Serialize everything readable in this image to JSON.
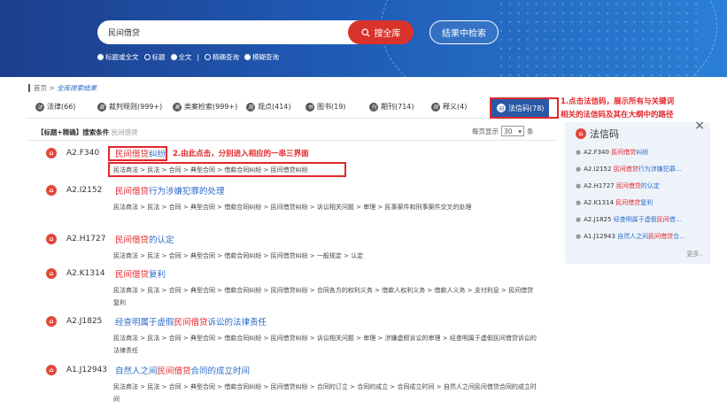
{
  "search": {
    "query": "民间借贷",
    "btn_all": "搜全库",
    "btn_within": "结果中检索",
    "options": [
      {
        "label": "标题或全文",
        "on": true
      },
      {
        "label": "标题",
        "on": false
      },
      {
        "label": "全文",
        "on": true
      },
      {
        "label": "精确查询",
        "on": false
      },
      {
        "label": "模糊查询",
        "on": true
      }
    ]
  },
  "breadcrumb": {
    "home": "首页",
    "sep": " > ",
    "current": "全库搜索结果"
  },
  "tabs": [
    {
      "label": "法律(66)",
      "icon": "法"
    },
    {
      "label": "裁判规则(999+)",
      "icon": "裁"
    },
    {
      "label": "类案检索(999+)",
      "icon": "案"
    },
    {
      "label": "观点(414)",
      "icon": "观"
    },
    {
      "label": "图书(19)",
      "icon": "书"
    },
    {
      "label": "期刊(714)",
      "icon": "刊"
    },
    {
      "label": "释义(4)",
      "icon": "释"
    },
    {
      "label": "法信码(78)",
      "icon": "码"
    }
  ],
  "conditions": {
    "label": "【标题+精确】搜索条件",
    "value": "民间借贷"
  },
  "perpage": {
    "before": "每页显示",
    "value": "30",
    "after": "条"
  },
  "annotations": {
    "note1": "2.由此点击，分别进入相应的一串三界面",
    "note2_line1": "1.点击法信码，展示所有与关键词",
    "note2_line2": "相关的法信码及其在大纲中的路径"
  },
  "results": [
    {
      "code": "A2.F340",
      "pre": "",
      "hl": "民间借贷",
      "post": "纠纷",
      "path": "民法商法 > 民法 > 合同 > 典型合同 > 借款合同纠纷 > 民间借贷纠纷"
    },
    {
      "code": "A2.I2152",
      "pre": "",
      "hl": "民间借贷",
      "post": "行为涉嫌犯罪的处理",
      "path": "民法商法 > 民法 > 合同 > 典型合同 > 借款合同纠纷 > 民间借贷纠纷 > 诉讼相关问题 > 审理 > 民事案件和刑事案件交叉的处理"
    },
    {
      "code": "A2.H1727",
      "pre": "",
      "hl": "民间借贷",
      "post": "的认定",
      "path": "民法商法 > 民法 > 合同 > 典型合同 > 借款合同纠纷 > 民间借贷纠纷 > 一般规定 > 认定"
    },
    {
      "code": "A2.K1314",
      "pre": "",
      "hl": "民间借贷",
      "post": "复利",
      "path": "民法商法 > 民法 > 合同 > 典型合同 > 借款合同纠纷 > 民间借贷纠纷 > 合同各方的权利义务 > 借款人权利义务 > 借款人义务 > 支付利息 > 民间借贷复利"
    },
    {
      "code": "A2.J1825",
      "pre": "经查明属于虚假",
      "hl": "民间借贷",
      "post": "诉讼的法律责任",
      "path": "民法商法 > 民法 > 合同 > 典型合同 > 借款合同纠纷 > 民间借贷纠纷 > 诉讼相关问题 > 审理 > 涉嫌虚假诉讼的审理 > 经查明属于虚假民间借贷诉讼的法律责任"
    },
    {
      "code": "A1.J12943",
      "pre": "自然人之间",
      "hl": "民间借贷",
      "post": "合同的成立时间",
      "path": "民法商法 > 民法 > 合同 > 典型合同 > 借款合同纠纷 > 民间借贷纠纷 > 合同的订立 > 合同的成立 > 合同成立时间 > 自然人之间民间借贷合同的成立时间"
    }
  ],
  "panel": {
    "title": "法信码",
    "more": "更多..",
    "items": [
      {
        "code": "A2.F340",
        "pre": "",
        "hl": "民间借贷",
        "post": "纠纷"
      },
      {
        "code": "A2.I2152",
        "pre": "",
        "hl": "民间借贷",
        "post": "行为涉嫌犯罪..."
      },
      {
        "code": "A2.H1727",
        "pre": "",
        "hl": "民间借贷",
        "post": "的认定"
      },
      {
        "code": "A2.K1314",
        "pre": "",
        "hl": "民间借贷",
        "post": "复利"
      },
      {
        "code": "A2.J1825",
        "pre": "经查明属于虚假",
        "hl": "民间",
        "post": "借..."
      },
      {
        "code": "A1.J12943",
        "pre": "自然人之间",
        "hl": "民间借贷",
        "post": "合..."
      }
    ]
  },
  "colors": {
    "accent": "#2a58a6",
    "highlight": "#e3262b",
    "link": "#2c6bc9"
  }
}
